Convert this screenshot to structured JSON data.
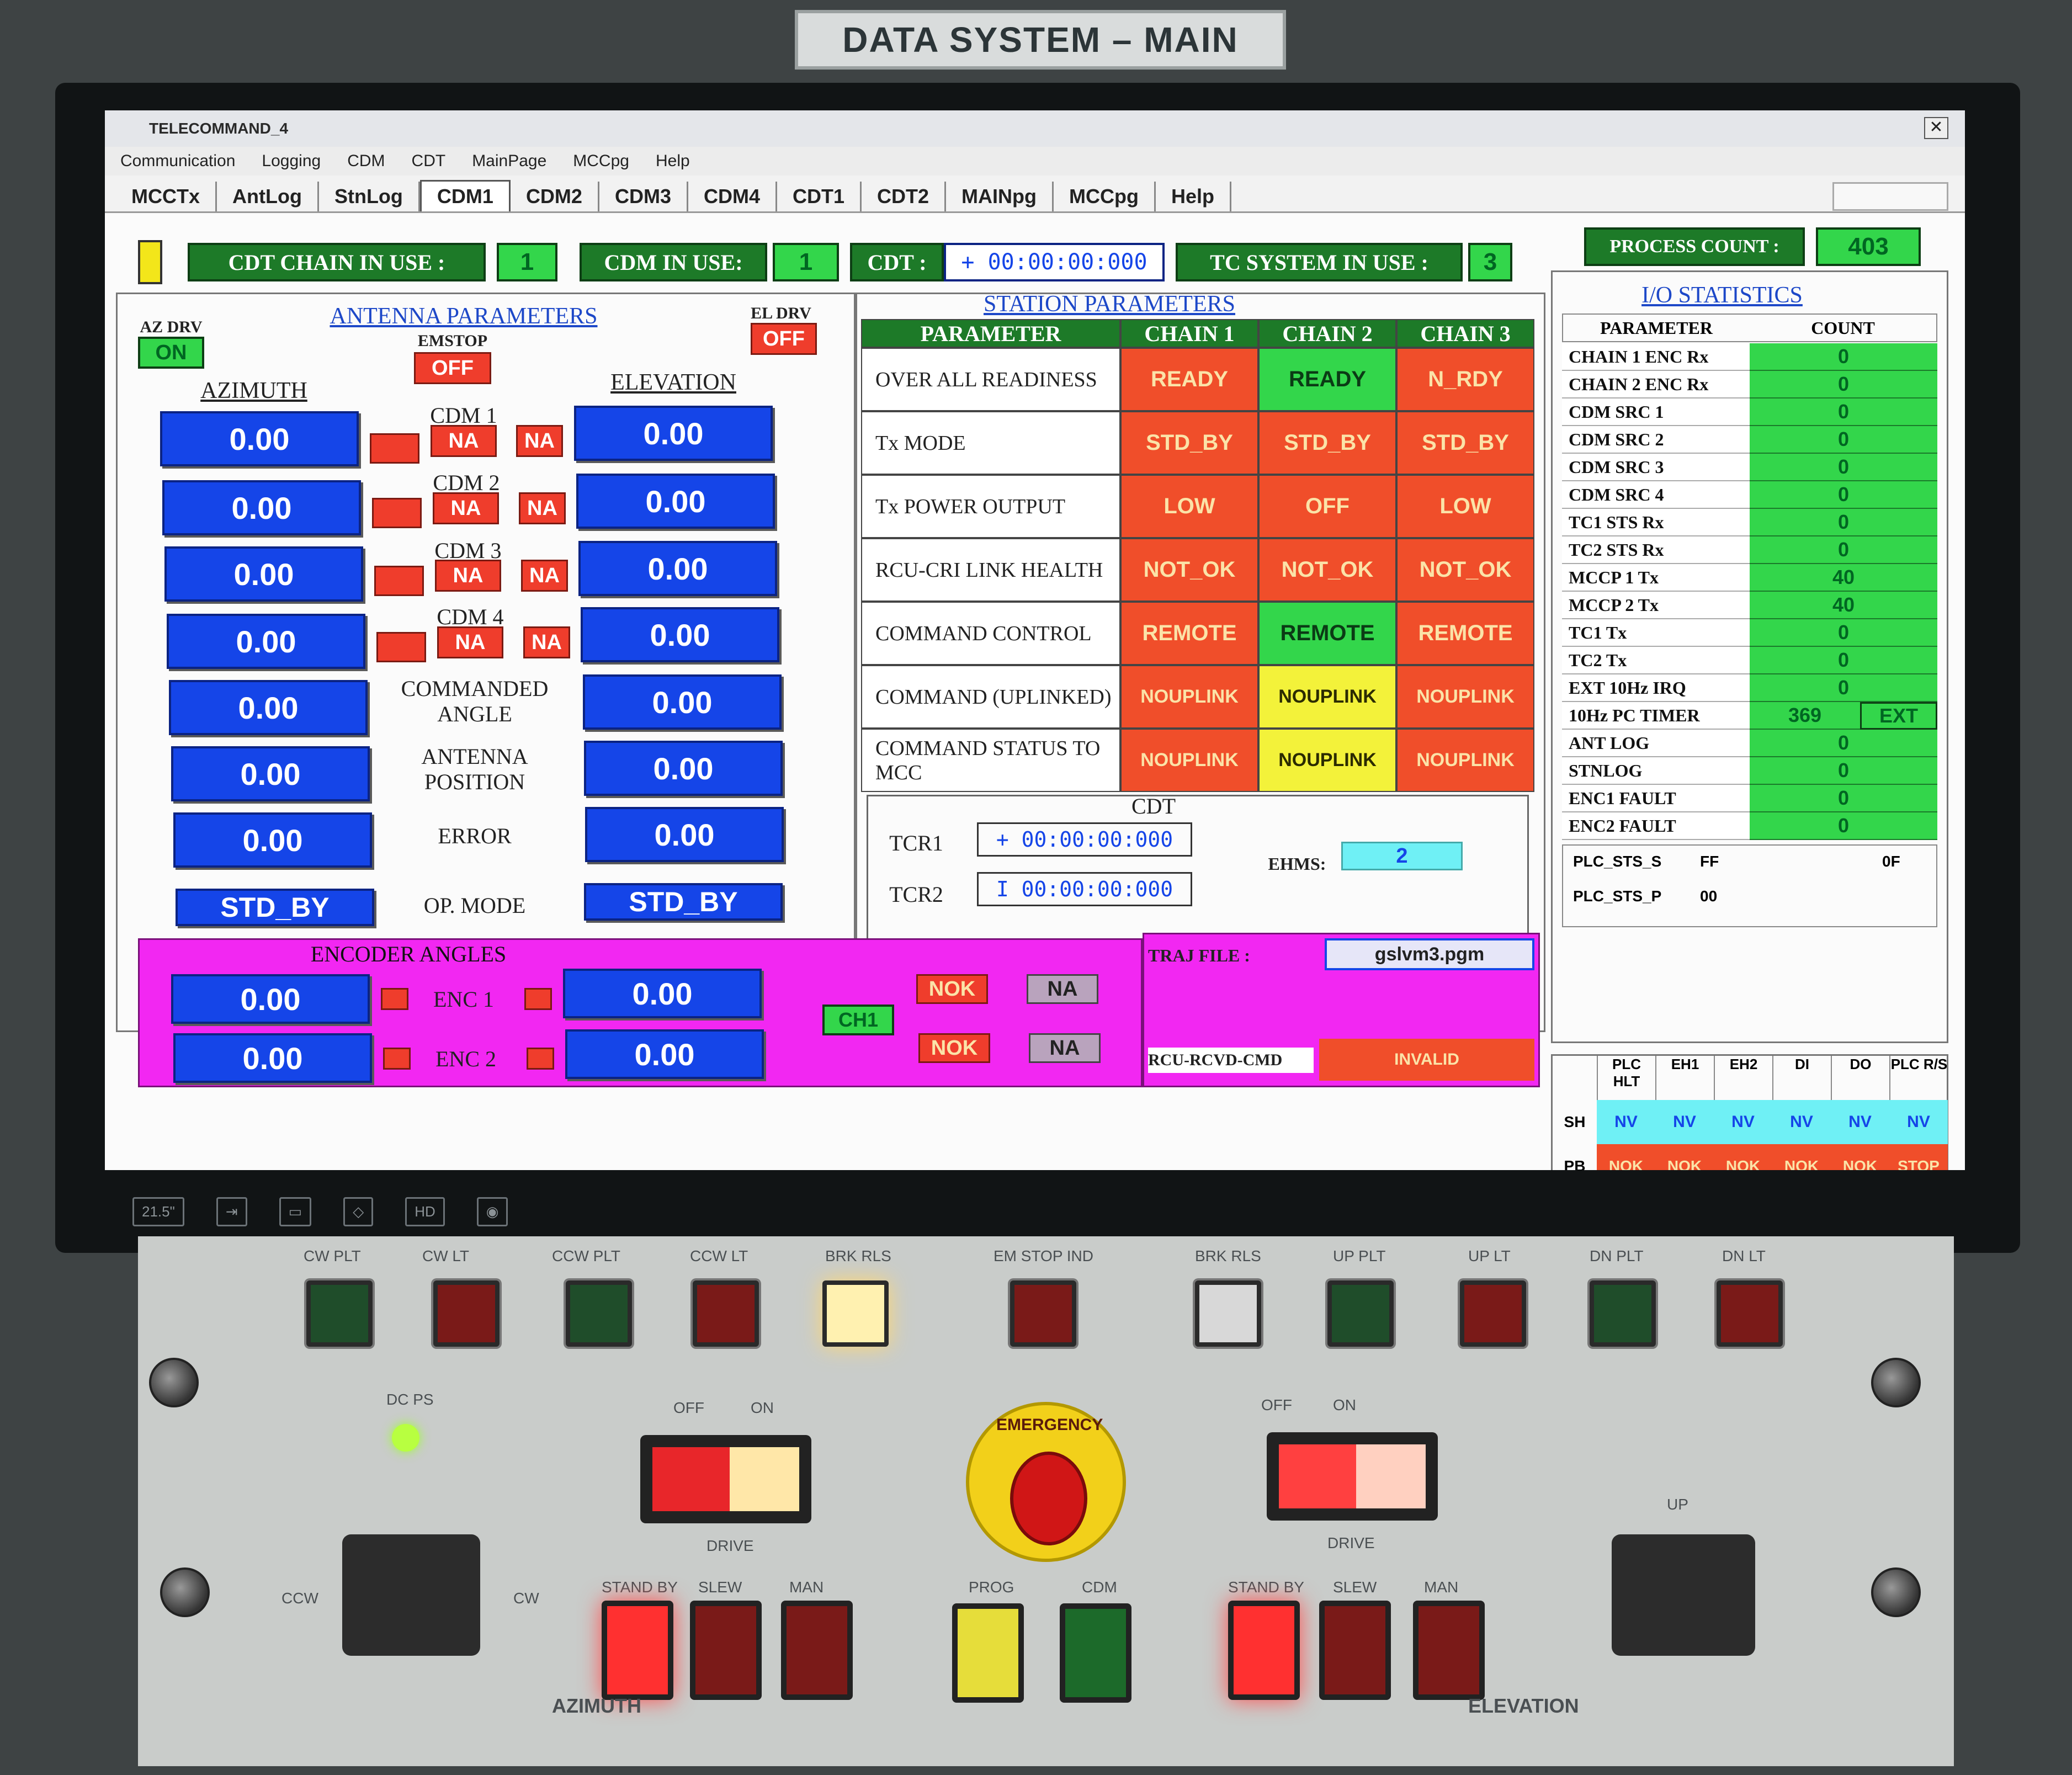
{
  "plate": {
    "label": "DATA SYSTEM – MAIN"
  },
  "window": {
    "title": "TELECOMMAND_4",
    "close": "✕"
  },
  "menu": [
    "Communication",
    "Logging",
    "CDM",
    "CDT",
    "MainPage",
    "MCCpg",
    "Help"
  ],
  "tabs": [
    "MCCTx",
    "AntLog",
    "StnLog",
    "CDM1",
    "CDM2",
    "CDM3",
    "CDM4",
    "CDT1",
    "CDT2",
    "MAINpg",
    "MCCpg",
    "Help"
  ],
  "status": {
    "cdt_chain_label": "CDT CHAIN IN USE :",
    "cdt_chain_value": "1",
    "cdm_label": "CDM IN USE:",
    "cdm_value": "1",
    "cdt_label": "CDT :",
    "cdt_value": "+ 00:00:00:000",
    "tc_label": "TC SYSTEM IN USE :",
    "tc_value": "3",
    "process_label": "PROCESS COUNT :",
    "process_value": "403"
  },
  "antenna": {
    "title": "ANTENNA PARAMETERS",
    "az_drv_label": "AZ DRV",
    "az_drv_value": "ON",
    "emstop_label": "EMSTOP",
    "emstop_value": "OFF",
    "el_drv_label": "EL DRV",
    "el_drv_value": "OFF",
    "azimuth_header": "AZIMUTH",
    "elevation_header": "ELEVATION",
    "rows": [
      {
        "label": "CDM 1",
        "az": "0.00",
        "el": "0.00",
        "na1": "NA",
        "na2": "NA"
      },
      {
        "label": "CDM 2",
        "az": "0.00",
        "el": "0.00",
        "na1": "NA",
        "na2": "NA"
      },
      {
        "label": "CDM 3",
        "az": "0.00",
        "el": "0.00",
        "na1": "NA",
        "na2": "NA"
      },
      {
        "label": "CDM 4",
        "az": "0.00",
        "el": "0.00",
        "na1": "NA",
        "na2": "NA"
      }
    ],
    "lower": [
      {
        "label": "COMMANDED ANGLE",
        "az": "0.00",
        "el": "0.00"
      },
      {
        "label": "ANTENNA POSITION",
        "az": "0.00",
        "el": "0.00"
      },
      {
        "label": "ERROR",
        "az": "0.00",
        "el": "0.00"
      }
    ],
    "op_mode_label": "OP. MODE",
    "op_mode_az": "STD_BY",
    "op_mode_el": "STD_BY"
  },
  "station": {
    "title": "STATION PARAMETERS",
    "headers": [
      "PARAMETER",
      "CHAIN 1",
      "CHAIN 2",
      "CHAIN 3"
    ],
    "rows": [
      {
        "param": "OVER ALL READINESS",
        "c1": "READY",
        "c2": "READY",
        "c3": "N_RDY",
        "k1": "red",
        "k2": "green",
        "k3": "red"
      },
      {
        "param": "Tx MODE",
        "c1": "STD_BY",
        "c2": "STD_BY",
        "c3": "STD_BY",
        "k1": "red",
        "k2": "red",
        "k3": "red"
      },
      {
        "param": "Tx POWER OUTPUT",
        "c1": "LOW",
        "c2": "OFF",
        "c3": "LOW",
        "k1": "red",
        "k2": "red",
        "k3": "red"
      },
      {
        "param": "RCU-CRI LINK HEALTH",
        "c1": "NOT_OK",
        "c2": "NOT_OK",
        "c3": "NOT_OK",
        "k1": "red",
        "k2": "red",
        "k3": "red"
      },
      {
        "param": "COMMAND CONTROL",
        "c1": "REMOTE",
        "c2": "REMOTE",
        "c3": "REMOTE",
        "k1": "red",
        "k2": "green",
        "k3": "red"
      },
      {
        "param": "COMMAND (UPLINKED)",
        "c1": "NOUPLINK",
        "c2": "NOUPLINK",
        "c3": "NOUPLINK",
        "k1": "red",
        "k2": "yellow",
        "k3": "red"
      },
      {
        "param": "COMMAND STATUS TO MCC",
        "c1": "NOUPLINK",
        "c2": "NOUPLINK",
        "c3": "NOUPLINK",
        "k1": "red",
        "k2": "yellow",
        "k3": "red"
      }
    ]
  },
  "cdt": {
    "title": "CDT",
    "tcr1_label": "TCR1",
    "tcr1_value": "+ 00:00:00:000",
    "tcr2_label": "TCR2",
    "tcr2_value": "I 00:00:00:000",
    "ehms_label": "EHMS:",
    "ehms_value": "2"
  },
  "encoder": {
    "title": "ENCODER ANGLES",
    "enc1_label": "ENC 1",
    "enc1_az": "0.00",
    "enc1_el": "0.00",
    "enc2_label": "ENC 2",
    "enc2_az": "0.00",
    "enc2_el": "0.00",
    "ch_label": "CH1",
    "nok1": "NOK",
    "nok2": "NOK",
    "na1": "NA",
    "na2": "NA"
  },
  "traj": {
    "label": "TRAJ FILE :",
    "value": "gslvm3.pgm",
    "rcu_label": "RCU-RCVD-CMD",
    "rcu_value": "INVALID"
  },
  "io": {
    "title": "I/O STATISTICS",
    "header_param": "PARAMETER",
    "header_count": "COUNT",
    "rows": [
      {
        "name": "CHAIN 1 ENC Rx",
        "value": "0"
      },
      {
        "name": "CHAIN 2 ENC Rx",
        "value": "0"
      },
      {
        "name": "CDM SRC 1",
        "value": "0"
      },
      {
        "name": "CDM SRC 2",
        "value": "0"
      },
      {
        "name": "CDM SRC 3",
        "value": "0"
      },
      {
        "name": "CDM SRC 4",
        "value": "0"
      },
      {
        "name": "TC1 STS Rx",
        "value": "0"
      },
      {
        "name": "TC2 STS Rx",
        "value": "0"
      },
      {
        "name": "MCCP 1 Tx",
        "value": "40"
      },
      {
        "name": "MCCP 2 Tx",
        "value": "40"
      },
      {
        "name": "TC1 Tx",
        "value": "0"
      },
      {
        "name": "TC2 Tx",
        "value": "0"
      },
      {
        "name": "EXT 10Hz IRQ",
        "value": "0"
      },
      {
        "name": "10Hz PC TIMER",
        "value": "369",
        "extra": "EXT"
      },
      {
        "name": "ANT LOG",
        "value": "0"
      },
      {
        "name": "STNLOG",
        "value": "0"
      },
      {
        "name": "ENC1 FAULT",
        "value": "0"
      },
      {
        "name": "ENC2 FAULT",
        "value": "0"
      }
    ],
    "plc_s_label": "PLC_STS_S",
    "plc_s_value": "FF",
    "plc_s_extra": "0F",
    "plc_p_label": "PLC_STS_P",
    "plc_p_value": "00"
  },
  "plc": {
    "headers": [
      "",
      "PLC HLT",
      "EH1",
      "EH2",
      "DI",
      "DO",
      "PLC R/S"
    ],
    "sh_label": "SH",
    "sh_values": [
      "NV",
      "NV",
      "NV",
      "NV",
      "NV",
      "NV"
    ],
    "pb_label": "PB",
    "pb_values": [
      "NOK",
      "NOK",
      "NOK",
      "NOK",
      "NOK",
      "STOP"
    ]
  },
  "monitor_strip": [
    "21.5\"",
    "HD"
  ],
  "console": {
    "lamps": [
      "CW PLT",
      "CW LT",
      "CCW PLT",
      "CCW LT",
      "BRK RLS",
      "EM STOP IND",
      "BRK RLS",
      "UP PLT",
      "UP LT",
      "DN PLT",
      "DN LT"
    ],
    "dc_ps": "DC PS",
    "off": "OFF",
    "on": "ON",
    "drive": "DRIVE",
    "emergency": "EMERGENCY",
    "ccw": "CCW",
    "cw": "CW",
    "up": "UP",
    "az_buttons": [
      "STAND BY",
      "SLEW",
      "MAN"
    ],
    "mid_buttons": [
      "PROG",
      "CDM"
    ],
    "el_buttons": [
      "STAND BY",
      "SLEW",
      "MAN"
    ],
    "azimuth": "AZIMUTH",
    "elevation": "ELEVATION"
  },
  "colors": {
    "green_val": "#33d64b",
    "blue_val": "#1545e8",
    "red": "#f04e2a",
    "magenta": "#f227f2",
    "cyan": "#6ff0f5",
    "yellow": "#f3f23a"
  }
}
